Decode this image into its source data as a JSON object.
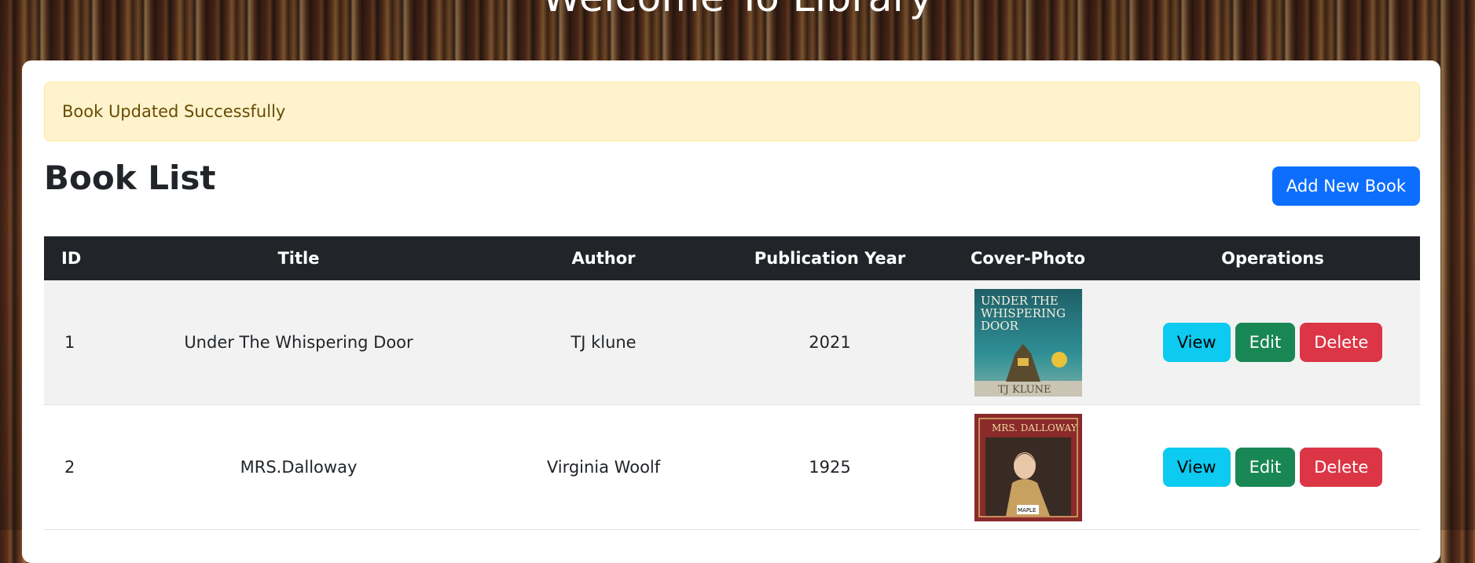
{
  "page": {
    "heading": "Welcome To Library"
  },
  "alert": {
    "message": "Book Updated Successfully"
  },
  "book_list": {
    "title": "Book List",
    "add_button_label": "Add New Book",
    "columns": [
      "ID",
      "Title",
      "Author",
      "Publication Year",
      "Cover-Photo",
      "Operations"
    ],
    "rows": [
      {
        "id": "1",
        "title": "Under The Whispering Door",
        "author": "TJ klune",
        "year": "2021",
        "cover_lines": [
          "UNDER THE",
          "WHISPERING",
          "DOOR",
          "TJ KLUNE"
        ]
      },
      {
        "id": "2",
        "title": "MRS.Dalloway",
        "author": "Virginia Woolf",
        "year": "1925",
        "cover_lines": [
          "MRS. DALLOWAY",
          "MAPLE"
        ]
      }
    ],
    "operations": {
      "view": "View",
      "edit": "Edit",
      "delete": "Delete"
    }
  },
  "colors": {
    "primary": "#0d6efd",
    "info": "#0dcaf0",
    "success": "#198754",
    "danger": "#dc3545",
    "warning_bg": "#fff3cd",
    "table_header": "#212529"
  }
}
